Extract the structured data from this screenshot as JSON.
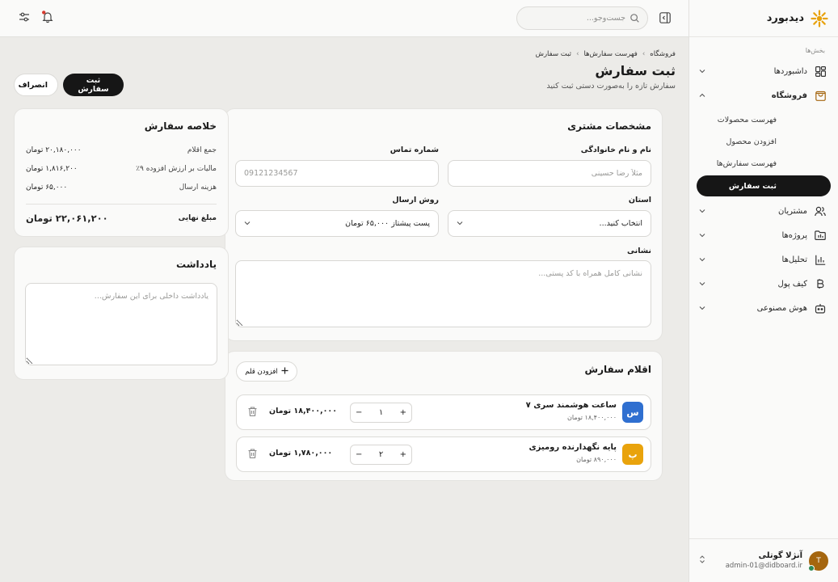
{
  "brand": {
    "name": "دیدبورد"
  },
  "sidebar": {
    "section_label": "بخش‌ها",
    "items": [
      {
        "label": "داشبوردها",
        "icon": "dashboard-icon"
      },
      {
        "label": "فروشگاه",
        "icon": "shopping-bag-icon"
      },
      {
        "label": "مشتریان",
        "icon": "users-icon"
      },
      {
        "label": "پروژه‌ها",
        "icon": "folder-icon"
      },
      {
        "label": "تحلیل‌ها",
        "icon": "chart-icon"
      },
      {
        "label": "کیف پول",
        "icon": "bitcoin-icon"
      },
      {
        "label": "هوش مصنوعی",
        "icon": "robot-icon"
      }
    ],
    "store_sub": [
      {
        "label": "فهرست محصولات"
      },
      {
        "label": "افزودن محصول"
      },
      {
        "label": "فهرست سفارش‌ها"
      },
      {
        "label": "ثبت سفارش"
      }
    ],
    "user": {
      "initial": "T",
      "name": "آنژلا گوتلی",
      "email": "admin-01@didboard.ir"
    }
  },
  "topbar": {
    "search_placeholder": "جست‌وجو..."
  },
  "page": {
    "breadcrumb": [
      "فروشگاه",
      "فهرست سفارش‌ها",
      "ثبت سفارش"
    ],
    "title": "ثبت سفارش",
    "subtitle": "سفارش تازه را به‌صورت دستی ثبت کنید",
    "submit_label": "ثبت سفارش",
    "cancel_label": "انصراف"
  },
  "customer": {
    "title": "مشخصات مشتری",
    "name_label": "نام و نام خانوادگی",
    "name_placeholder": "مثلاً رضا حسینی",
    "phone_label": "شماره تماس",
    "phone_placeholder": "09121234567",
    "province_label": "استان",
    "province_value": "انتخاب کنید...",
    "shipping_label": "روش ارسال",
    "shipping_value": "پست پیشتاز ۶۵,۰۰۰ تومان",
    "address_label": "نشانی",
    "address_placeholder": "نشانی کامل همراه با کد پستی..."
  },
  "items": {
    "title": "اقلام سفارش",
    "add_label": "افزودن قلم",
    "rows": [
      {
        "badge": "س",
        "badge_color": "#2f6fd0",
        "name": "ساعت هوشمند سری ۷",
        "price": "۱۸,۴۰۰,۰۰۰ تومان",
        "qty": "۱",
        "total": "۱۸,۴۰۰,۰۰۰ تومان"
      },
      {
        "badge": "پ",
        "badge_color": "#e9a30c",
        "name": "پایه نگهدارنده رومیزی",
        "price": "۸۹۰,۰۰۰ تومان",
        "qty": "۲",
        "total": "۱,۷۸۰,۰۰۰ تومان"
      }
    ]
  },
  "summary": {
    "title": "خلاصه سفارش",
    "rows": [
      {
        "k": "جمع اقلام",
        "v": "۲۰,۱۸۰,۰۰۰ تومان"
      },
      {
        "k": "مالیات بر ارزش افزوده ۹٪",
        "v": "۱,۸۱۶,۲۰۰ تومان"
      },
      {
        "k": "هزینه ارسال",
        "v": "۶۵,۰۰۰ تومان"
      }
    ],
    "final_label": "مبلغ نهایی",
    "final_value": "۲۲,۰۶۱,۲۰۰ تومان"
  },
  "note": {
    "title": "یادداشت",
    "placeholder": "یادداشت داخلی برای این سفارش..."
  }
}
